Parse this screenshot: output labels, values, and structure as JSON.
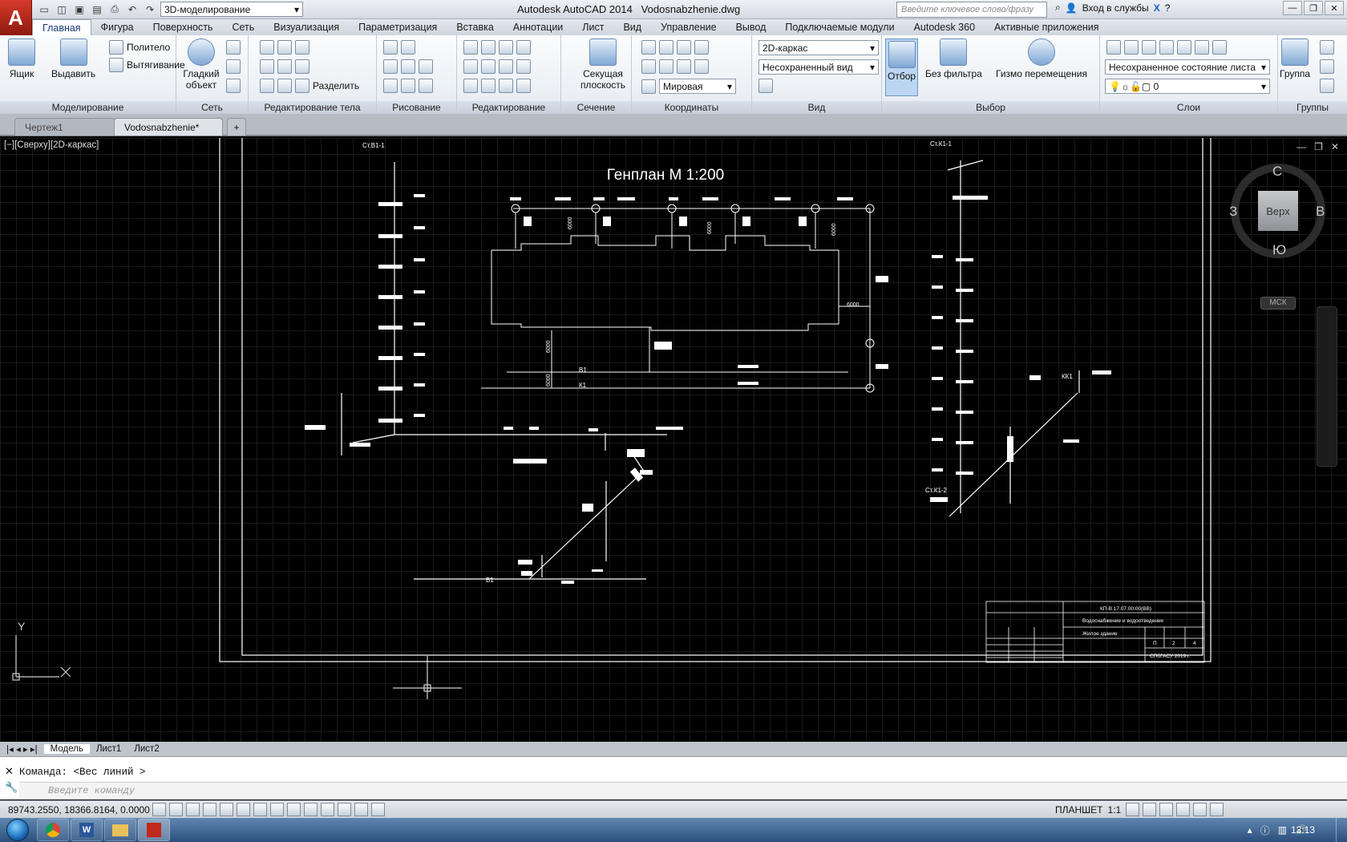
{
  "app": {
    "logo": "A",
    "title": "Autodesk AutoCAD 2014",
    "file": "Vodosnabzhenie.dwg"
  },
  "workspace": "3D-моделирование",
  "search_placeholder": "Введите ключевое слово/фразу",
  "login": "Вход в службы",
  "menu_tabs": [
    "Главная",
    "Фигура",
    "Поверхность",
    "Сеть",
    "Визуализация",
    "Параметризация",
    "Вставка",
    "Аннотации",
    "Лист",
    "Вид",
    "Управление",
    "Вывод",
    "Подключаемые модули",
    "Autodesk 360",
    "Активные приложения"
  ],
  "ribbon": {
    "modeling": {
      "title": "Моделирование",
      "box": "Ящик",
      "extrude": "Выдавить",
      "polysolid": "Политело",
      "presspull": "Вытягивание"
    },
    "mesh": {
      "title": "Сеть",
      "smooth": "Гладкий объект"
    },
    "solid_edit": {
      "title": "Редактирование тела",
      "separate": "Разделить"
    },
    "draw": {
      "title": "Рисование"
    },
    "modify": {
      "title": "Редактирование"
    },
    "section": {
      "title": "Сечение",
      "plane": "Секущая плоскость"
    },
    "coords": {
      "title": "Координаты",
      "world": "Мировая"
    },
    "view": {
      "title": "Вид",
      "visual_style": "2D-каркас",
      "named_view": "Несохраненный вид"
    },
    "selection": {
      "title": "Выбор",
      "culling": "Отбор",
      "nofilter": "Без фильтра",
      "gizmo": "Гизмо перемещения"
    },
    "layers": {
      "title": "Слои",
      "state": "Несохраненное состояние листа",
      "current": "0"
    },
    "groups": {
      "title": "Группы",
      "group": "Группа"
    }
  },
  "doc_tabs": [
    "Чертеж1",
    "Vodosnabzhenie*"
  ],
  "viewport_label": "[−][Сверху][2D-каркас]",
  "viewcube": {
    "face": "Верх",
    "n": "С",
    "s": "Ю",
    "e": "В",
    "w": "З",
    "ucs": "МСК"
  },
  "drawing": {
    "title": "Генплан М 1:200",
    "labels": {
      "st1": "Ст.В1-1",
      "st2": "Ст.К1-1",
      "st3": "Ст.К1-2",
      "kk": "КК1",
      "b1": "В1",
      "k1": "К1",
      "b1b": "В1"
    },
    "dims": [
      "6000",
      "6000",
      "6000",
      "6000",
      "6000",
      "6000"
    ],
    "stamp": {
      "code": "КП-В.17.07.00.00(ВВ)",
      "name": "Водоснабжение и водоотведение",
      "object": "Жилое здание",
      "stage": "П",
      "sheet": "2",
      "sheets": "4",
      "org": "СПбГАСУ 2019 г."
    }
  },
  "layout_tabs": [
    "Модель",
    "Лист1",
    "Лист2"
  ],
  "command": {
    "history": "Команда:  <Вес линий >",
    "placeholder": "Введите команду"
  },
  "status": {
    "coords": "89743.2550, 18366.8164, 0.0000",
    "space": "ПЛАНШЕТ",
    "scale": "1:1"
  },
  "clock": "13:13"
}
